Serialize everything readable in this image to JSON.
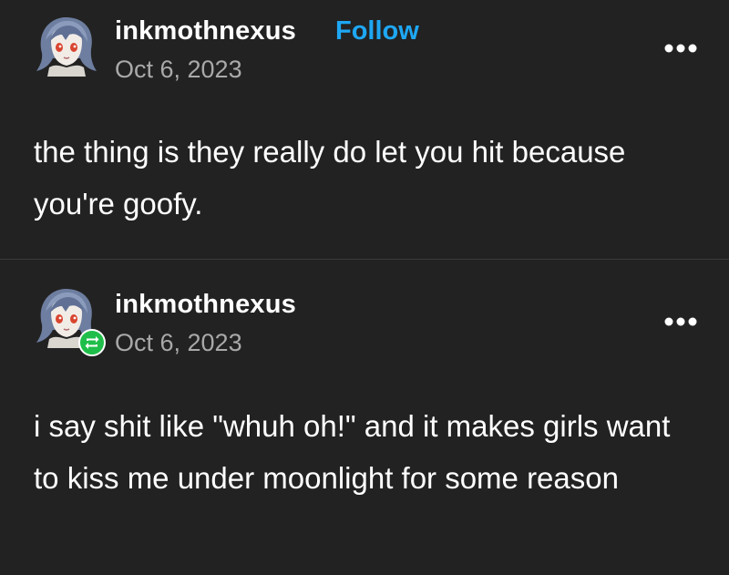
{
  "posts": [
    {
      "username": "inkmothnexus",
      "follow_label": "Follow",
      "date": "Oct 6, 2023",
      "text": "the thing is they really do let you hit because you're goofy."
    },
    {
      "username": "inkmothnexus",
      "date": "Oct 6, 2023",
      "text": "i say shit like \"whuh oh!\" and it makes girls want to kiss me under moonlight for some reason"
    }
  ],
  "icons": {
    "avatar": "avatar",
    "more": "more-options-icon",
    "reblog": "reblog-icon"
  },
  "colors": {
    "background": "#222222",
    "follow": "#1ea7f3",
    "date": "#a9a9a9",
    "reblog_badge": "#1fbe4a"
  }
}
